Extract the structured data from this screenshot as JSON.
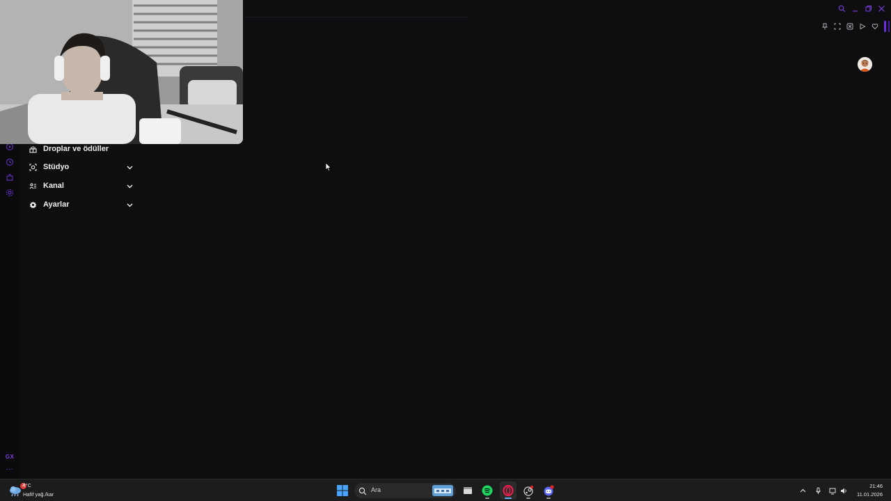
{
  "menu": {
    "items": [
      {
        "label": "Droplar ve ödüller",
        "icon": "gift-icon",
        "has_chevron": false
      },
      {
        "label": "Stüdyo",
        "icon": "studio-icon",
        "has_chevron": true
      },
      {
        "label": "Kanal",
        "icon": "channel-icon",
        "has_chevron": true
      },
      {
        "label": "Ayarlar",
        "icon": "gear-icon",
        "has_chevron": true
      }
    ]
  },
  "rail": {
    "gx_label": "GX",
    "more_label": "···",
    "icons": [
      "player-icon",
      "history-icon",
      "extensions-icon",
      "settings-icon"
    ]
  },
  "taskbar": {
    "weather": {
      "temp": "4°C",
      "desc": "Hafif yağ./kar",
      "badge": "2"
    },
    "search": {
      "placeholder": "Ara"
    },
    "apps": [
      "windows-start-icon",
      "file-manager-icon",
      "spotify-icon",
      "opera-gx-icon",
      "steam-icon",
      "discord-icon"
    ],
    "clock": {
      "time": "21:46",
      "date": "11.01.2026"
    }
  },
  "colors": {
    "background": "#0e0e10",
    "accent": "#7b3fe4",
    "text": "#efeff1",
    "taskbar": "#1c1c1c"
  }
}
